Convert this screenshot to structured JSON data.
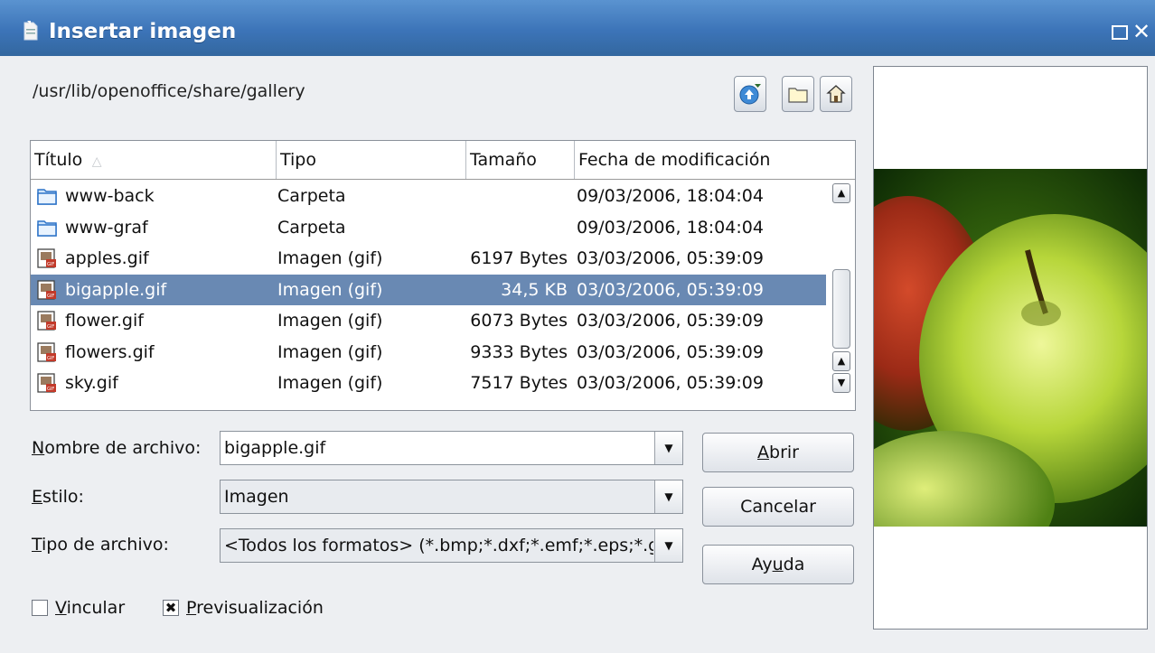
{
  "window": {
    "title": "Insertar imagen"
  },
  "path": "/usr/lib/openoffice/share/gallery",
  "toolbar": {
    "up_icon": "up-level-icon",
    "new_folder_icon": "new-folder-icon",
    "home_icon": "home-icon"
  },
  "columns": [
    "Título",
    "Tipo",
    "Tamaño",
    "Fecha de modificación"
  ],
  "files": [
    {
      "name": "www-back",
      "type": "Carpeta",
      "size": "",
      "date": "09/03/2006, 18:04:04",
      "icon": "folder-icon"
    },
    {
      "name": "www-graf",
      "type": "Carpeta",
      "size": "",
      "date": "09/03/2006, 18:04:04",
      "icon": "folder-icon"
    },
    {
      "name": "apples.gif",
      "type": "Imagen (gif)",
      "size": "6197 Bytes",
      "date": "03/03/2006, 05:39:09",
      "icon": "gif-file-icon"
    },
    {
      "name": "bigapple.gif",
      "type": "Imagen (gif)",
      "size": "34,5 KB",
      "date": "03/03/2006, 05:39:09",
      "icon": "gif-file-icon",
      "selected": true
    },
    {
      "name": "flower.gif",
      "type": "Imagen (gif)",
      "size": "6073 Bytes",
      "date": "03/03/2006, 05:39:09",
      "icon": "gif-file-icon"
    },
    {
      "name": "flowers.gif",
      "type": "Imagen (gif)",
      "size": "9333 Bytes",
      "date": "03/03/2006, 05:39:09",
      "icon": "gif-file-icon"
    },
    {
      "name": "sky.gif",
      "type": "Imagen (gif)",
      "size": "7517 Bytes",
      "date": "03/03/2006, 05:39:09",
      "icon": "gif-file-icon"
    }
  ],
  "form": {
    "filename_label_pre": "",
    "filename_label_u": "N",
    "filename_label_post": "ombre de archivo:",
    "filename_value": "bigapple.gif",
    "style_label_u": "E",
    "style_label_post": "stilo:",
    "style_value": "Imagen",
    "filetype_label_u": "T",
    "filetype_label_post": "ipo de archivo:",
    "filetype_value": "<Todos los formatos> (*.bmp;*.dxf;*.emf;*.eps;*.gif"
  },
  "buttons": {
    "open_u": "A",
    "open_post": "brir",
    "cancel": "Cancelar",
    "help_pre": "Ay",
    "help_u": "u",
    "help_post": "da"
  },
  "options": {
    "link_u": "V",
    "link_post": "incular",
    "link_checked": false,
    "preview_u": "P",
    "preview_post": "revisualización",
    "preview_checked": true
  },
  "colors": {
    "titlebar": "#3c74b8",
    "selection": "#6989b3"
  }
}
